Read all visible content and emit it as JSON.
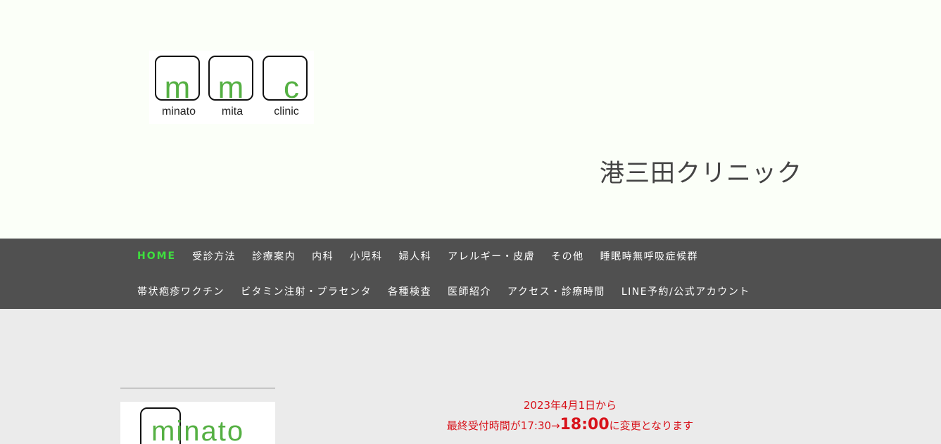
{
  "header": {
    "logo": {
      "letters": [
        "m",
        "m",
        "c"
      ],
      "captions": [
        "minato",
        "mita",
        "clinic"
      ]
    },
    "site_title": "港三田クリニック"
  },
  "nav": {
    "row1": [
      "HOME",
      "受診方法",
      "診療案内",
      "内科",
      "小児科",
      "婦人科",
      "アレルギー・皮膚",
      "その他",
      "睡眠時無呼吸症候群"
    ],
    "row2": [
      "帯状疱疹ワクチン",
      "ビタミン注射・プラセンタ",
      "各種検査",
      "医師紹介",
      "アクセス・診療時間",
      "LINE予約/公式アカウント"
    ]
  },
  "sidebar": {
    "logo_word": "minato"
  },
  "notice": {
    "line1": "2023年4月1日から",
    "line2_prefix": "最終受付時間が17:30→",
    "line2_time": "18:00",
    "line2_suffix": "に変更となります"
  },
  "colors": {
    "header_bg": "#fbfff8",
    "nav_bg": "#505050",
    "nav_active": "#3ee03e",
    "logo_green": "#55b043",
    "notice_red": "#d8121a",
    "body_bg": "#ebebeb"
  }
}
